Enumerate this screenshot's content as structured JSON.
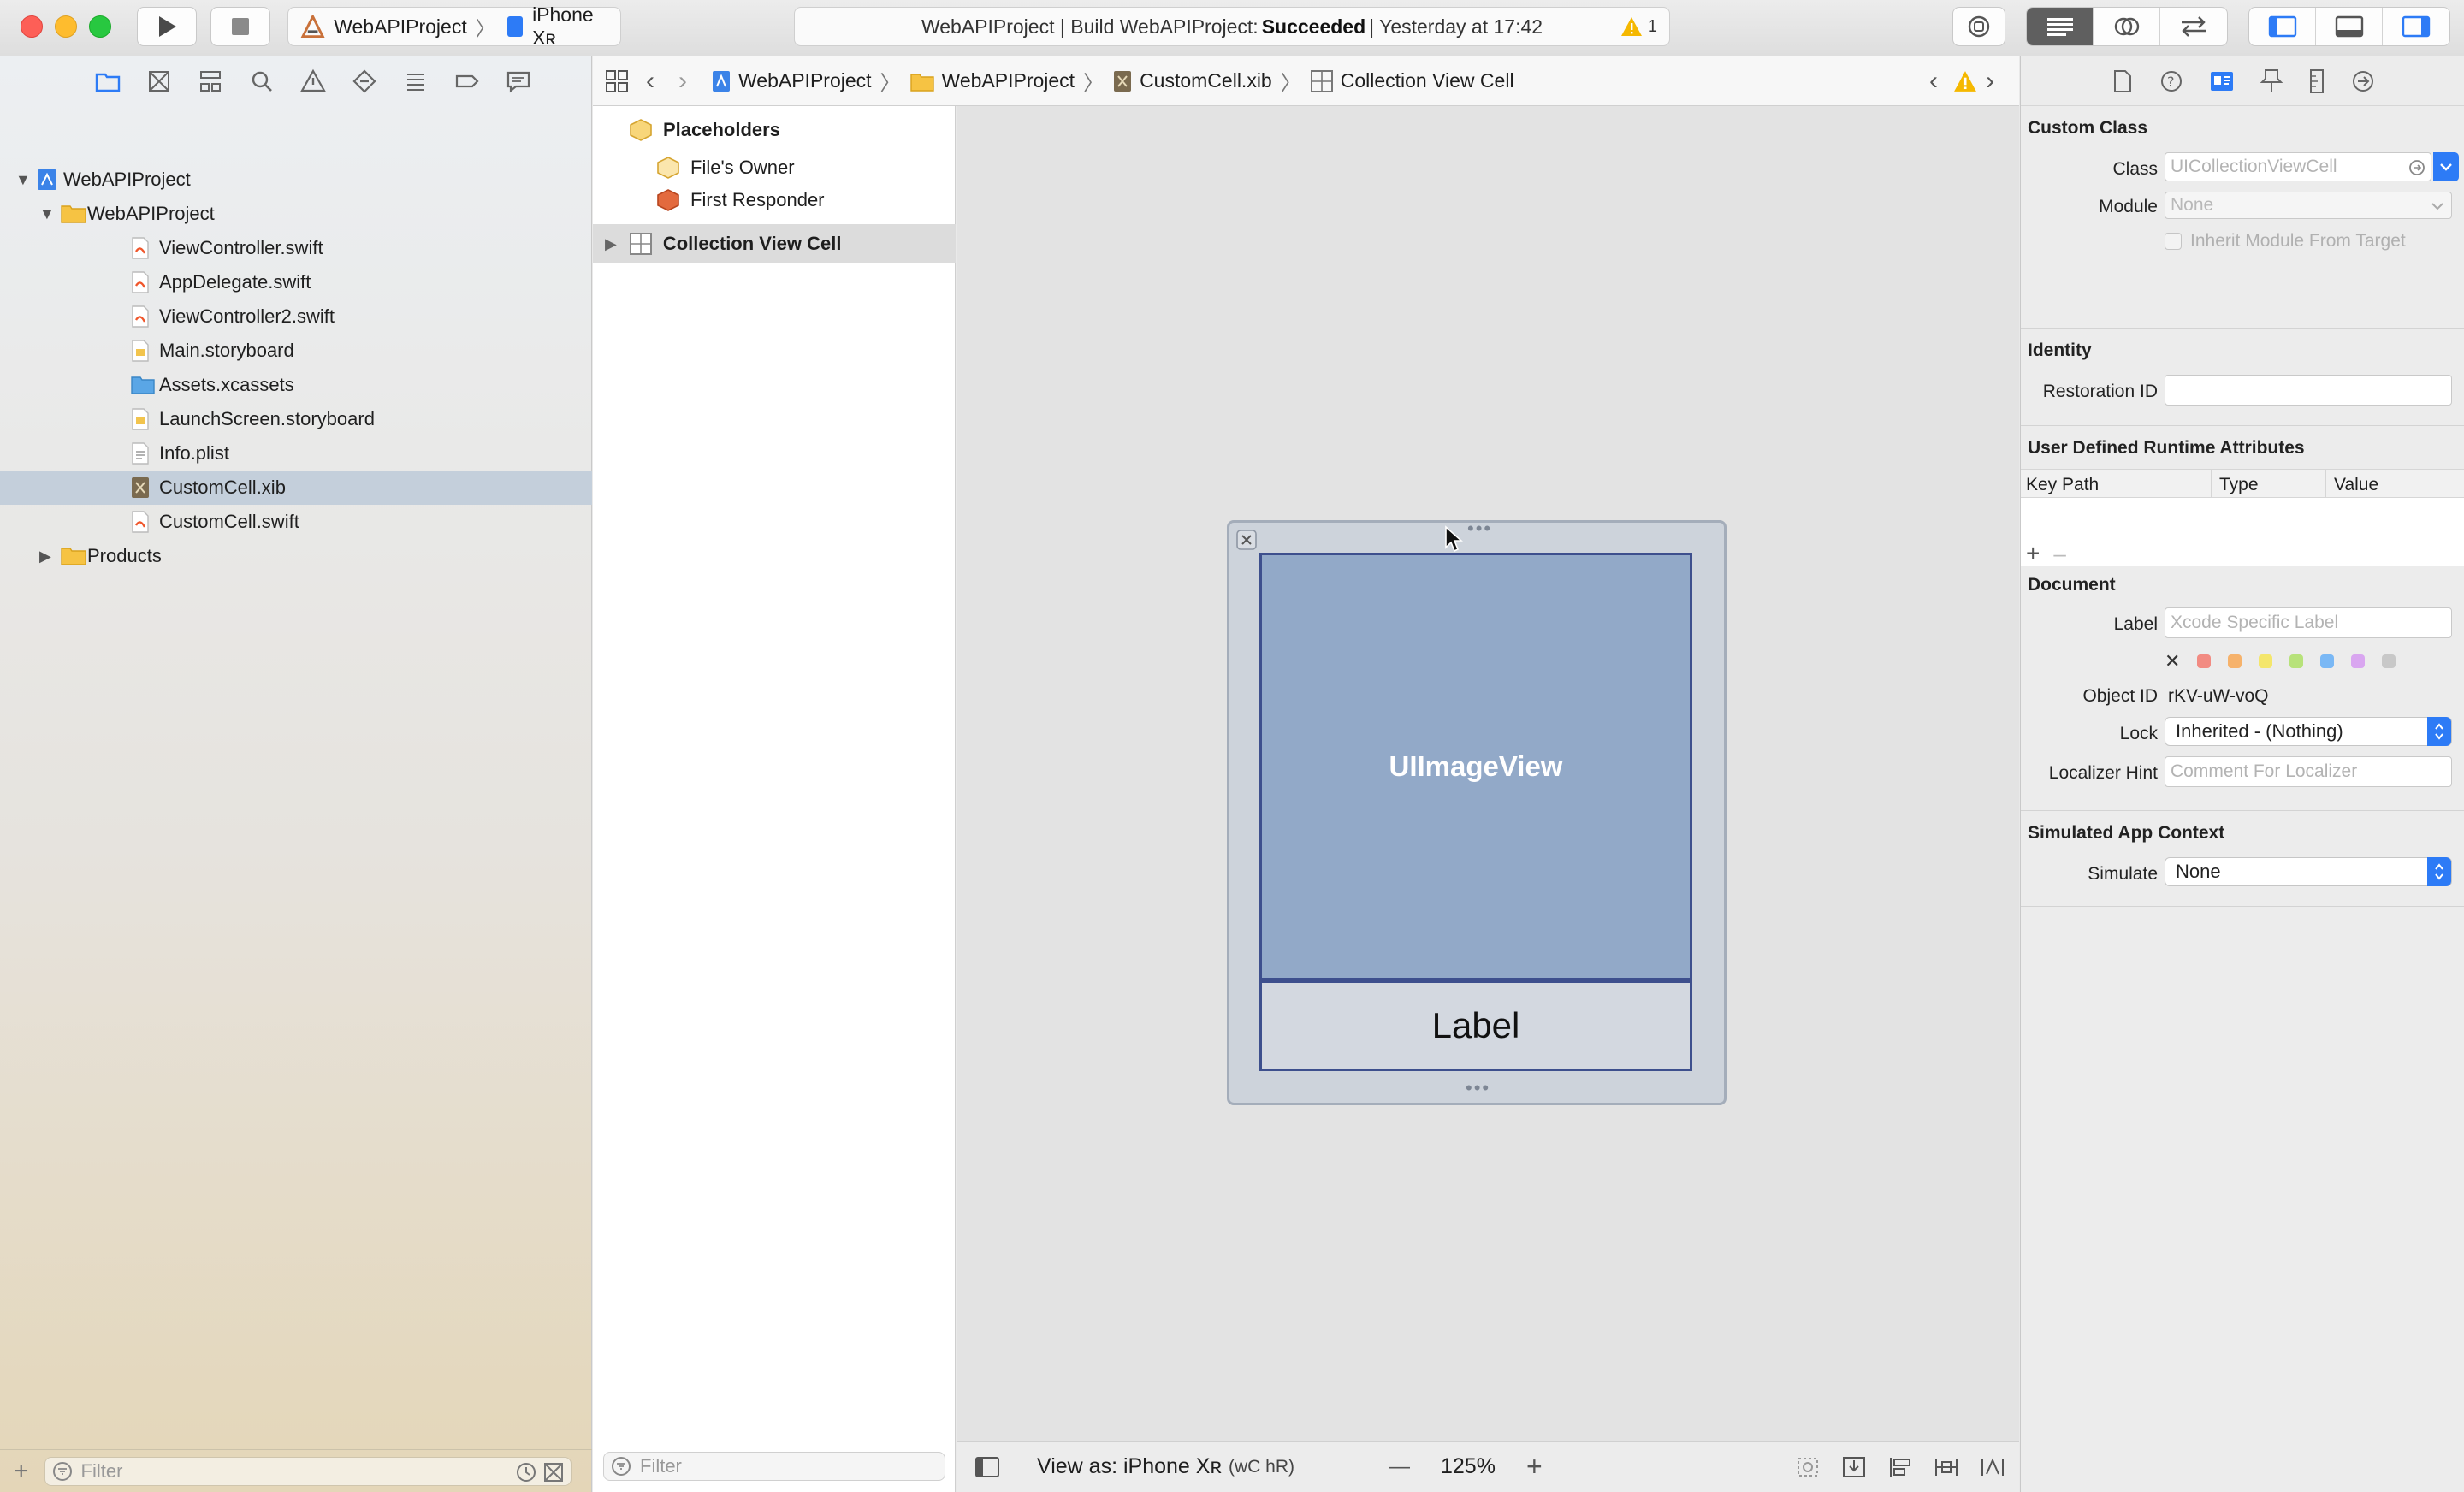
{
  "toolbar": {
    "scheme_project": "WebAPIProject",
    "scheme_device": "iPhone Xʀ",
    "status_prefix": "WebAPIProject | Build WebAPIProject:",
    "status_result": "Succeeded",
    "status_time": "| Yesterday at 17:42",
    "warning_count": "1"
  },
  "navigator": {
    "tree": [
      {
        "label": "WebAPIProject",
        "kind": "project"
      },
      {
        "label": "WebAPIProject",
        "kind": "group"
      },
      {
        "label": "ViewController.swift",
        "kind": "swift"
      },
      {
        "label": "AppDelegate.swift",
        "kind": "swift"
      },
      {
        "label": "ViewController2.swift",
        "kind": "swift"
      },
      {
        "label": "Main.storyboard",
        "kind": "storyboard"
      },
      {
        "label": "Assets.xcassets",
        "kind": "assets"
      },
      {
        "label": "LaunchScreen.storyboard",
        "kind": "storyboard"
      },
      {
        "label": "Info.plist",
        "kind": "plist"
      },
      {
        "label": "CustomCell.xib",
        "kind": "xib"
      },
      {
        "label": "CustomCell.swift",
        "kind": "swift"
      },
      {
        "label": "Products",
        "kind": "group"
      }
    ],
    "filter_placeholder": "Filter"
  },
  "jumpbar": {
    "crumbs": [
      "WebAPIProject",
      "WebAPIProject",
      "CustomCell.xib",
      "Collection View Cell"
    ]
  },
  "outline": {
    "placeholders": "Placeholders",
    "files_owner": "File's Owner",
    "first_responder": "First Responder",
    "cell": "Collection View Cell",
    "filter_placeholder": "Filter"
  },
  "canvas": {
    "image_view_label": "UIImageView",
    "label_text": "Label",
    "view_as": "View as: iPhone Xʀ",
    "size_class": "(wC hR)",
    "zoom": "125%",
    "zoom_minus": "—",
    "zoom_plus": "+"
  },
  "inspector": {
    "custom_class": {
      "title": "Custom Class",
      "class_label": "Class",
      "class_placeholder": "UICollectionViewCell",
      "module_label": "Module",
      "module_value": "None",
      "inherit_label": "Inherit Module From Target"
    },
    "identity": {
      "title": "Identity",
      "restoration_label": "Restoration ID"
    },
    "runtime_attrs": {
      "title": "User Defined Runtime Attributes",
      "col_key": "Key Path",
      "col_type": "Type",
      "col_value": "Value"
    },
    "document": {
      "title": "Document",
      "label_label": "Label",
      "label_placeholder": "Xcode Specific Label",
      "object_id_label": "Object ID",
      "object_id_value": "rKV-uW-voQ",
      "lock_label": "Lock",
      "lock_value": "Inherited - (Nothing)",
      "localizer_label": "Localizer Hint",
      "localizer_placeholder": "Comment For Localizer"
    },
    "simulated": {
      "title": "Simulated App Context",
      "simulate_label": "Simulate",
      "simulate_value": "None"
    }
  },
  "colors": {
    "selection": "#c4cfdb",
    "accent": "#2d7bf6",
    "image_view_fill": "#92a9c8",
    "warning": "#f5b800",
    "swatches": [
      "#f28b82",
      "#f6b26b",
      "#f4e66b",
      "#b7e27a",
      "#7ab8f5",
      "#d9a6f0",
      "#c8c8c8"
    ]
  }
}
